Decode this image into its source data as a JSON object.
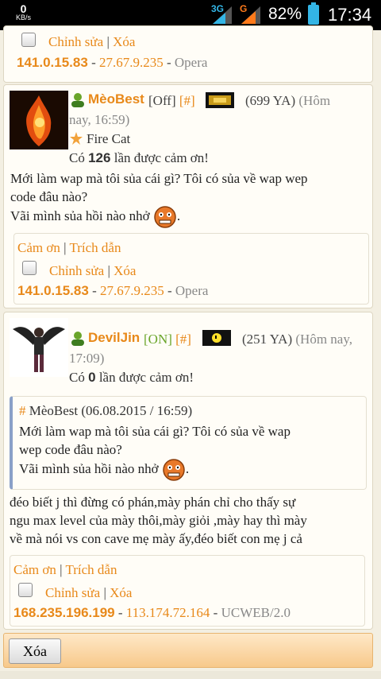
{
  "status": {
    "kbs_value": "0",
    "kbs_unit": "KB/s",
    "net1": "3G",
    "net2": "G",
    "battery_pct": "82%",
    "time": "17:34"
  },
  "top_card": {
    "edit": "Chỉnh sửa",
    "delete": "Xóa",
    "ip1": "141.0.15.83",
    "ip2": "27.67.9.235",
    "browser": "Opera"
  },
  "post1": {
    "username": "MèoBest",
    "status": "[Off]",
    "hash": "[#]",
    "points": "(699 YA)",
    "time1": "(Hôm",
    "time2": "nay, 16:59)",
    "rank": "Fire Cat",
    "thanks_pre": "Có",
    "thanks_count": "126",
    "thanks_post": "lần được cảm ơn!",
    "line1": "Mới làm wap mà tôi sủa cái gì? Tôi có sủa về wap wep",
    "line2": "code đâu nào?",
    "line3": "Vãi mình sủa hồi nào nhở",
    "thanks_btn": "Cảm ơn",
    "quote_btn": "Trích dẫn",
    "edit": "Chỉnh sửa",
    "delete": "Xóa",
    "ip1": "141.0.15.83",
    "ip2": "27.67.9.235",
    "browser": "Opera"
  },
  "post2": {
    "username": "DevilJin",
    "status": "[ON]",
    "hash": "[#]",
    "points": "(251 YA)",
    "time1": "(Hôm nay,",
    "time2": "17:09)",
    "thanks_pre": "Có",
    "thanks_count": "0",
    "thanks_post": "lần được cảm ơn!",
    "quote_hash": "#",
    "quote_head": "MèoBest (06.08.2015 / 16:59)",
    "quote_line1": "Mới làm wap mà tôi sủa cái gì? Tôi có sủa về wap",
    "quote_line2": "wep code đâu nào?",
    "quote_line3": "Vãi mình sủa hồi nào nhở",
    "line1": "đéo biết j thì đừng có phán,mày phán chỉ cho thấy sự",
    "line2": "ngu max level của mày thôi,mày giỏi ,mày hay thì mày",
    "line3": "về mà nói vs con cave mẹ mày ấy,đéo biết con mẹ j cả",
    "thanks_btn": "Cảm ơn",
    "quote_btn": "Trích dẫn",
    "edit": "Chỉnh sửa",
    "delete": "Xóa",
    "ip1": "168.235.196.199",
    "ip2": "113.174.72.164",
    "browser": "UCWEB/2.0"
  },
  "footer": {
    "delete_button": "Xóa"
  },
  "colors": {
    "link": "#e8891a",
    "online": "#6aa52a",
    "status_bar": "#000000"
  }
}
